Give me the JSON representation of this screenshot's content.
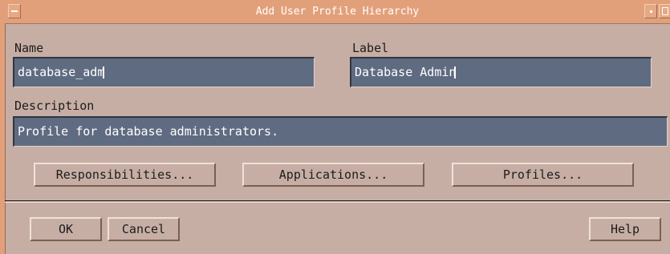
{
  "window": {
    "title": "Add User Profile Hierarchy"
  },
  "form": {
    "name_label": "Name",
    "name_value": "database_adm",
    "label_label": "Label",
    "label_value": "Database Admin",
    "description_label": "Description",
    "description_value": "Profile for database administrators."
  },
  "actions": {
    "responsibilities": "Responsibilities...",
    "applications": "Applications...",
    "profiles": "Profiles..."
  },
  "footer": {
    "ok": "OK",
    "cancel": "Cancel",
    "help": "Help"
  },
  "colors": {
    "titlebar": "#e2a07a",
    "window_bg": "#c7aea4",
    "field_bg": "#5f6b80"
  }
}
